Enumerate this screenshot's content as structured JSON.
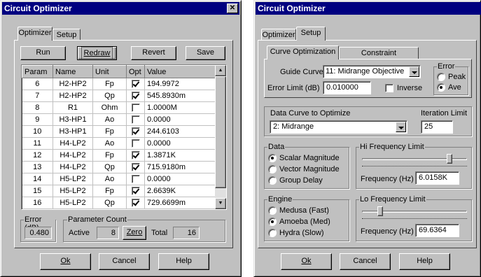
{
  "left": {
    "title": "Circuit Optimizer",
    "close": "✕",
    "tabs": [
      "Optimizer",
      "Setup"
    ],
    "buttons": {
      "run": "Run",
      "redraw": "Redraw",
      "revert": "Revert",
      "save": "Save"
    },
    "columns": [
      "Param",
      "Name",
      "Unit",
      "Opt",
      "Value"
    ],
    "rows": [
      {
        "param": "6",
        "name": "H2-HP2",
        "unit": "Fp",
        "opt": true,
        "value": "194.9972"
      },
      {
        "param": "7",
        "name": "H2-HP2",
        "unit": "Qp",
        "opt": true,
        "value": "545.8930m"
      },
      {
        "param": "8",
        "name": "R1",
        "unit": "Ohm",
        "opt": false,
        "value": "1.0000M"
      },
      {
        "param": "9",
        "name": "H3-HP1",
        "unit": "Ao",
        "opt": false,
        "value": "0.0000"
      },
      {
        "param": "10",
        "name": "H3-HP1",
        "unit": "Fp",
        "opt": true,
        "value": "244.6103"
      },
      {
        "param": "11",
        "name": "H4-LP2",
        "unit": "Ao",
        "opt": false,
        "value": "0.0000"
      },
      {
        "param": "12",
        "name": "H4-LP2",
        "unit": "Fp",
        "opt": true,
        "value": "1.3871K"
      },
      {
        "param": "13",
        "name": "H4-LP2",
        "unit": "Qp",
        "opt": true,
        "value": "715.9180m"
      },
      {
        "param": "14",
        "name": "H5-LP2",
        "unit": "Ao",
        "opt": false,
        "value": "0.0000"
      },
      {
        "param": "15",
        "name": "H5-LP2",
        "unit": "Fp",
        "opt": true,
        "value": "2.6639K"
      },
      {
        "param": "16",
        "name": "H5-LP2",
        "unit": "Qp",
        "opt": true,
        "value": "729.6699m"
      }
    ],
    "error_label": "Error (dB)",
    "error_value": "0.480",
    "param_count_label": "Parameter Count",
    "active_label": "Active",
    "active_value": "8",
    "zero_label": "Zero",
    "total_label": "Total",
    "total_value": "16",
    "ok": "Ok",
    "cancel": "Cancel",
    "help": "Help"
  },
  "right": {
    "title": "Circuit Optimizer",
    "tabs": [
      "Optimizer",
      "Setup"
    ],
    "subtabs": [
      "Curve Optimization",
      "Constraint Optimization"
    ],
    "guide_curve_label": "Guide Curve",
    "guide_curve_value": "11: Midrange Objective",
    "error_limit_label": "Error Limit (dB)",
    "error_limit_value": "0.010000",
    "inverse_label": "Inverse",
    "error_group": "Error",
    "peak": "Peak",
    "ave": "Ave",
    "data_curve_label": "Data Curve to Optimize",
    "data_curve_value": "2: Midrange",
    "iteration_label": "Iteration Limit",
    "iteration_value": "25",
    "data_group": "Data",
    "data_options": [
      "Scalar Magnitude",
      "Vector Magnitude",
      "Group Delay"
    ],
    "hi_group": "Hi Frequency Limit",
    "hi_freq_label": "Frequency (Hz)",
    "hi_freq_value": "6.0158K",
    "engine_group": "Engine",
    "engine_options": [
      "Medusa (Fast)",
      "Amoeba (Med)",
      "Hydra (Slow)"
    ],
    "lo_group": "Lo Frequency Limit",
    "lo_freq_label": "Frequency (Hz)",
    "lo_freq_value": "69.6364",
    "ok": "Ok",
    "cancel": "Cancel",
    "help": "Help"
  }
}
